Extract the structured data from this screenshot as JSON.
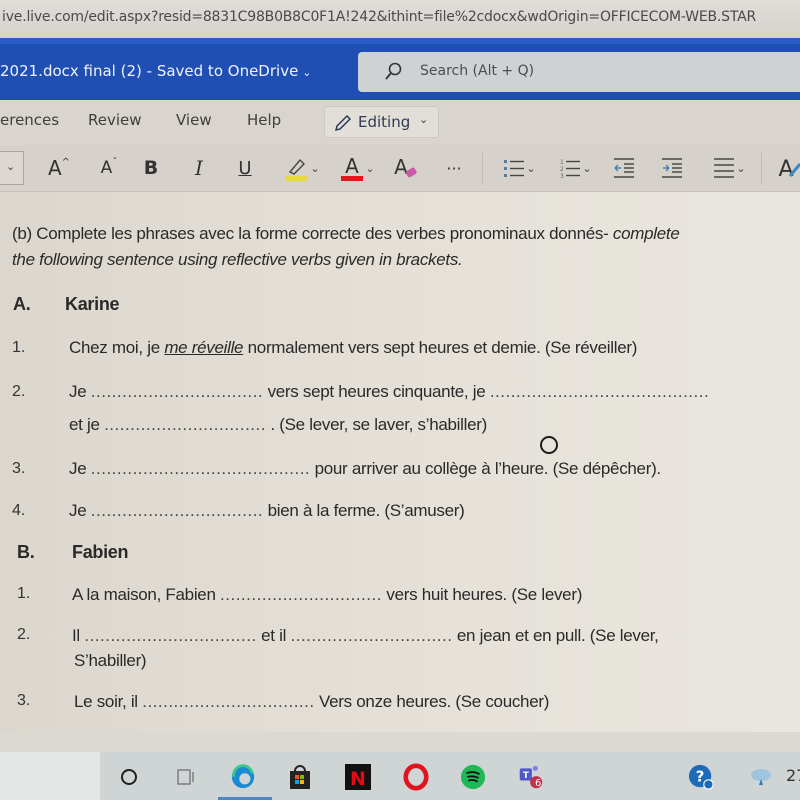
{
  "browser": {
    "url": "ive.live.com/edit.aspx?resid=8831C98B0B8C0F1A!242&ithint=file%2cdocx&wdOrigin=OFFICECOM-WEB.STAR"
  },
  "titlebar": {
    "doc_name": "2021.docx final (2)",
    "separator": " - ",
    "save_status": "Saved to OneDrive",
    "search_placeholder": "Search (Alt + Q)"
  },
  "ribbon_tabs": [
    {
      "label": "erences"
    },
    {
      "label": "Review"
    },
    {
      "label": "View"
    },
    {
      "label": "Help"
    }
  ],
  "mode": {
    "label": "Editing",
    "icon": "pencil-icon"
  },
  "toolbar": {
    "grow_font": "A",
    "shrink_font": "A",
    "bold": "B",
    "italic": "I",
    "underline": "U",
    "font_color": "A",
    "clear_formatting": "A",
    "more": "···",
    "highlight_color": "#e6d84a",
    "font_color_value": "#e01a1a",
    "styles": "A"
  },
  "document": {
    "instruction_prefix": "(b)  Complete les phrases avec la forme correcte des verbes pronominaux donnés- ",
    "instruction_italic": "complete",
    "instruction_line2": "the following sentence using reflective verbs given in brackets.",
    "sections": [
      {
        "letter": "A.",
        "name": "Karine",
        "items": [
          {
            "num": "1.",
            "before": "Chez moi, je ",
            "answer": "me réveille",
            "after": " normalement vers sept heures et demie. (Se réveiller)"
          },
          {
            "num": "2.",
            "line1_a": "Je ",
            "line1_b": " vers sept heures cinquante, je ",
            "line2_a": "et je ",
            "line2_b": " . (Se lever, se laver, s’habiller)"
          },
          {
            "num": "3.",
            "a": "Je ",
            "b": " pour arriver au collège à l’heure. (Se dépêcher)."
          },
          {
            "num": "4.",
            "a": "Je ",
            "b": "  bien à la ferme. (S’amuser)"
          }
        ]
      },
      {
        "letter": "B.",
        "name": "Fabien",
        "items": [
          {
            "num": "1.",
            "a": "A la maison, Fabien ",
            "b": " vers huit heures. (Se lever)"
          },
          {
            "num": "2.",
            "a": "Il ",
            "b": " et il ",
            "c": " en jean et en pull. (Se lever,",
            "line2": "S’habiller)"
          },
          {
            "num": "3.",
            "a": "Le soir, il ",
            "b": " Vers onze heures. (Se coucher)"
          }
        ]
      }
    ],
    "blank": ".................................",
    "blank_long": "..........................................",
    "blank_short": "..............................."
  },
  "taskbar": {
    "apps": [
      "cortana",
      "task-view",
      "edge",
      "store",
      "netflix",
      "opera",
      "spotify",
      "teams"
    ],
    "teams_badge": "6",
    "clock_partial": "27"
  }
}
